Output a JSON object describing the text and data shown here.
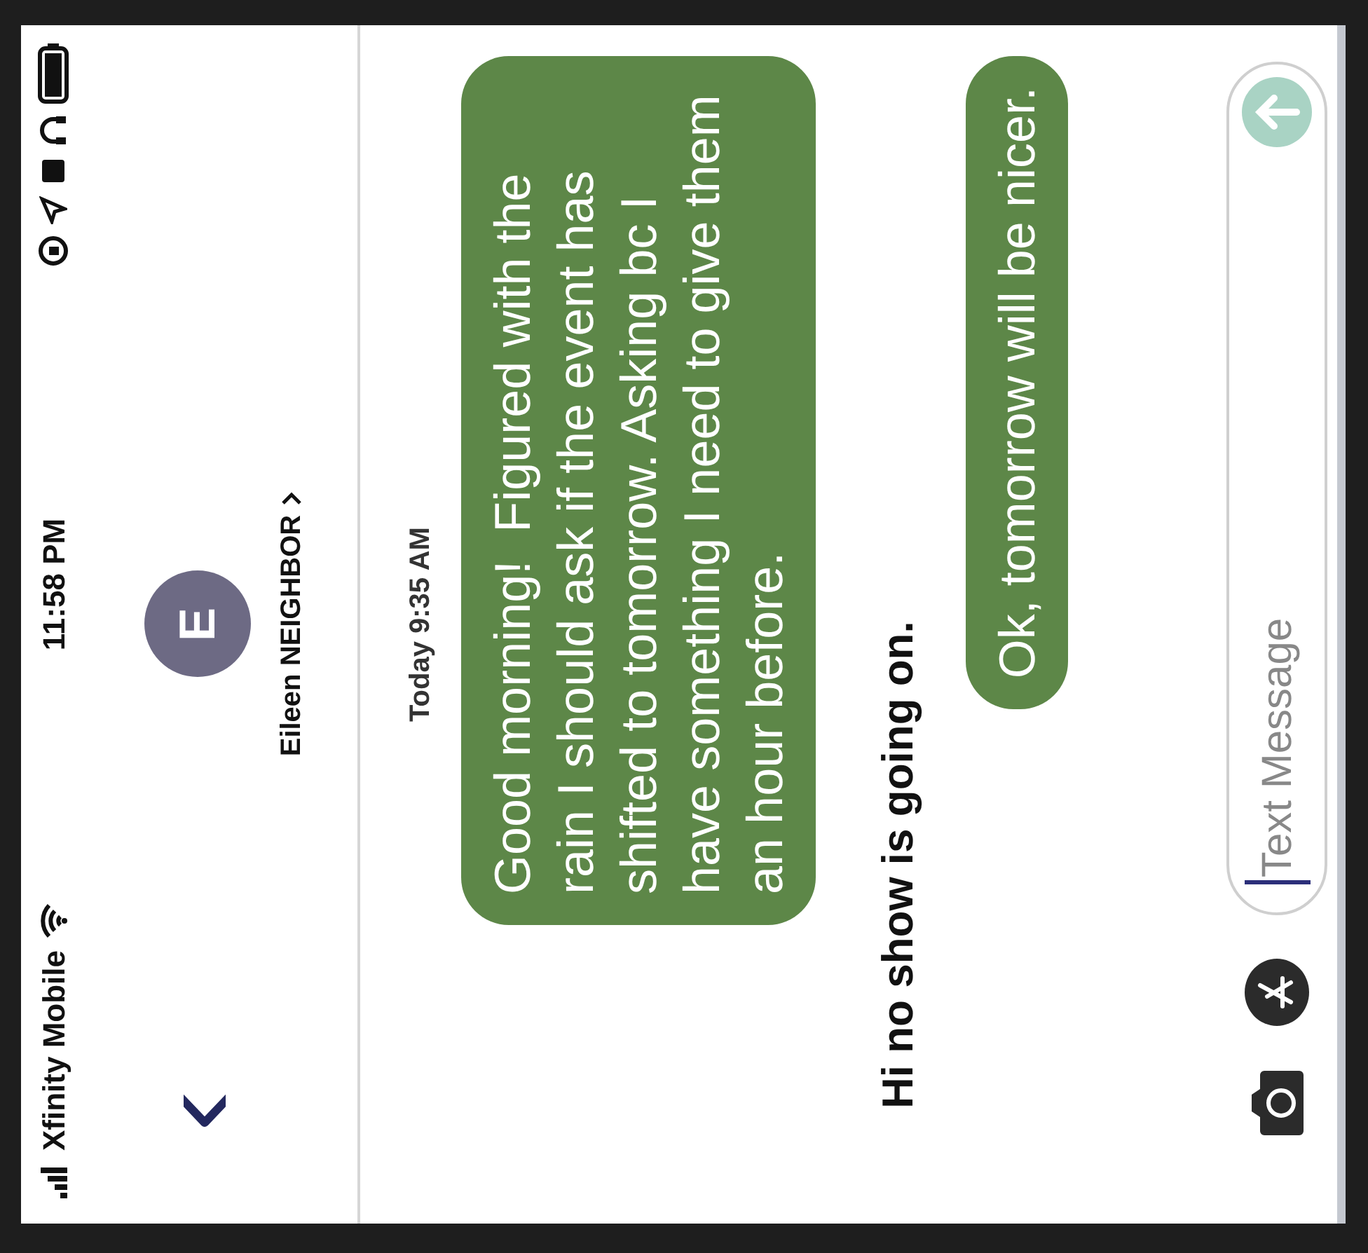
{
  "status_bar": {
    "carrier": "Xfinity Mobile",
    "time": "11:58 PM"
  },
  "header": {
    "avatar_initial": "E",
    "contact_name": "Eileen NEIGHBOR"
  },
  "timestamp": "Today 9:35 AM",
  "messages": [
    {
      "kind": "bubble",
      "text": "Good morning!  Figured with the rain I should ask if the event has shifted to tomorrow. Asking bc I have something I need to give them an hour before."
    },
    {
      "kind": "plain",
      "text": "Hi no show is going on."
    },
    {
      "kind": "bubble",
      "text": "Ok, tomorrow will be nicer."
    }
  ],
  "composer": {
    "placeholder": "Text Message"
  }
}
